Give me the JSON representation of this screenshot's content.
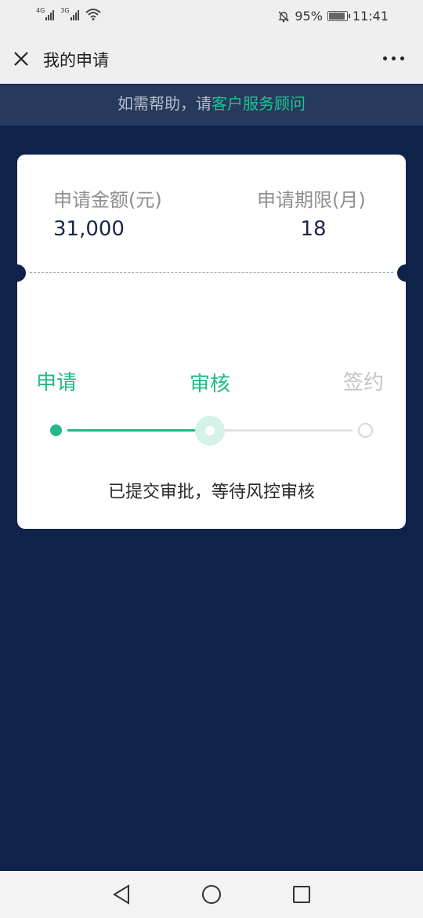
{
  "status_bar": {
    "network_1": "4G",
    "network_2": "3G",
    "battery_percent": "95%",
    "battery_level": 0.95,
    "time": "11:41"
  },
  "header": {
    "title": "我的申请"
  },
  "help_banner": {
    "prefix": "如需帮助，请",
    "link": "客户服务顾问"
  },
  "application": {
    "amount_label": "申请金额(元)",
    "amount_value": "31,000",
    "term_label": "申请期限(月)",
    "term_value": "18"
  },
  "progress": {
    "steps": [
      {
        "label": "申请",
        "state": "done"
      },
      {
        "label": "审核",
        "state": "current"
      },
      {
        "label": "签约",
        "state": "pending"
      }
    ],
    "status_message": "已提交审批，等待风控审核"
  },
  "colors": {
    "accent": "#21b98a",
    "background": "#0f224a",
    "banner": "#27395c"
  }
}
